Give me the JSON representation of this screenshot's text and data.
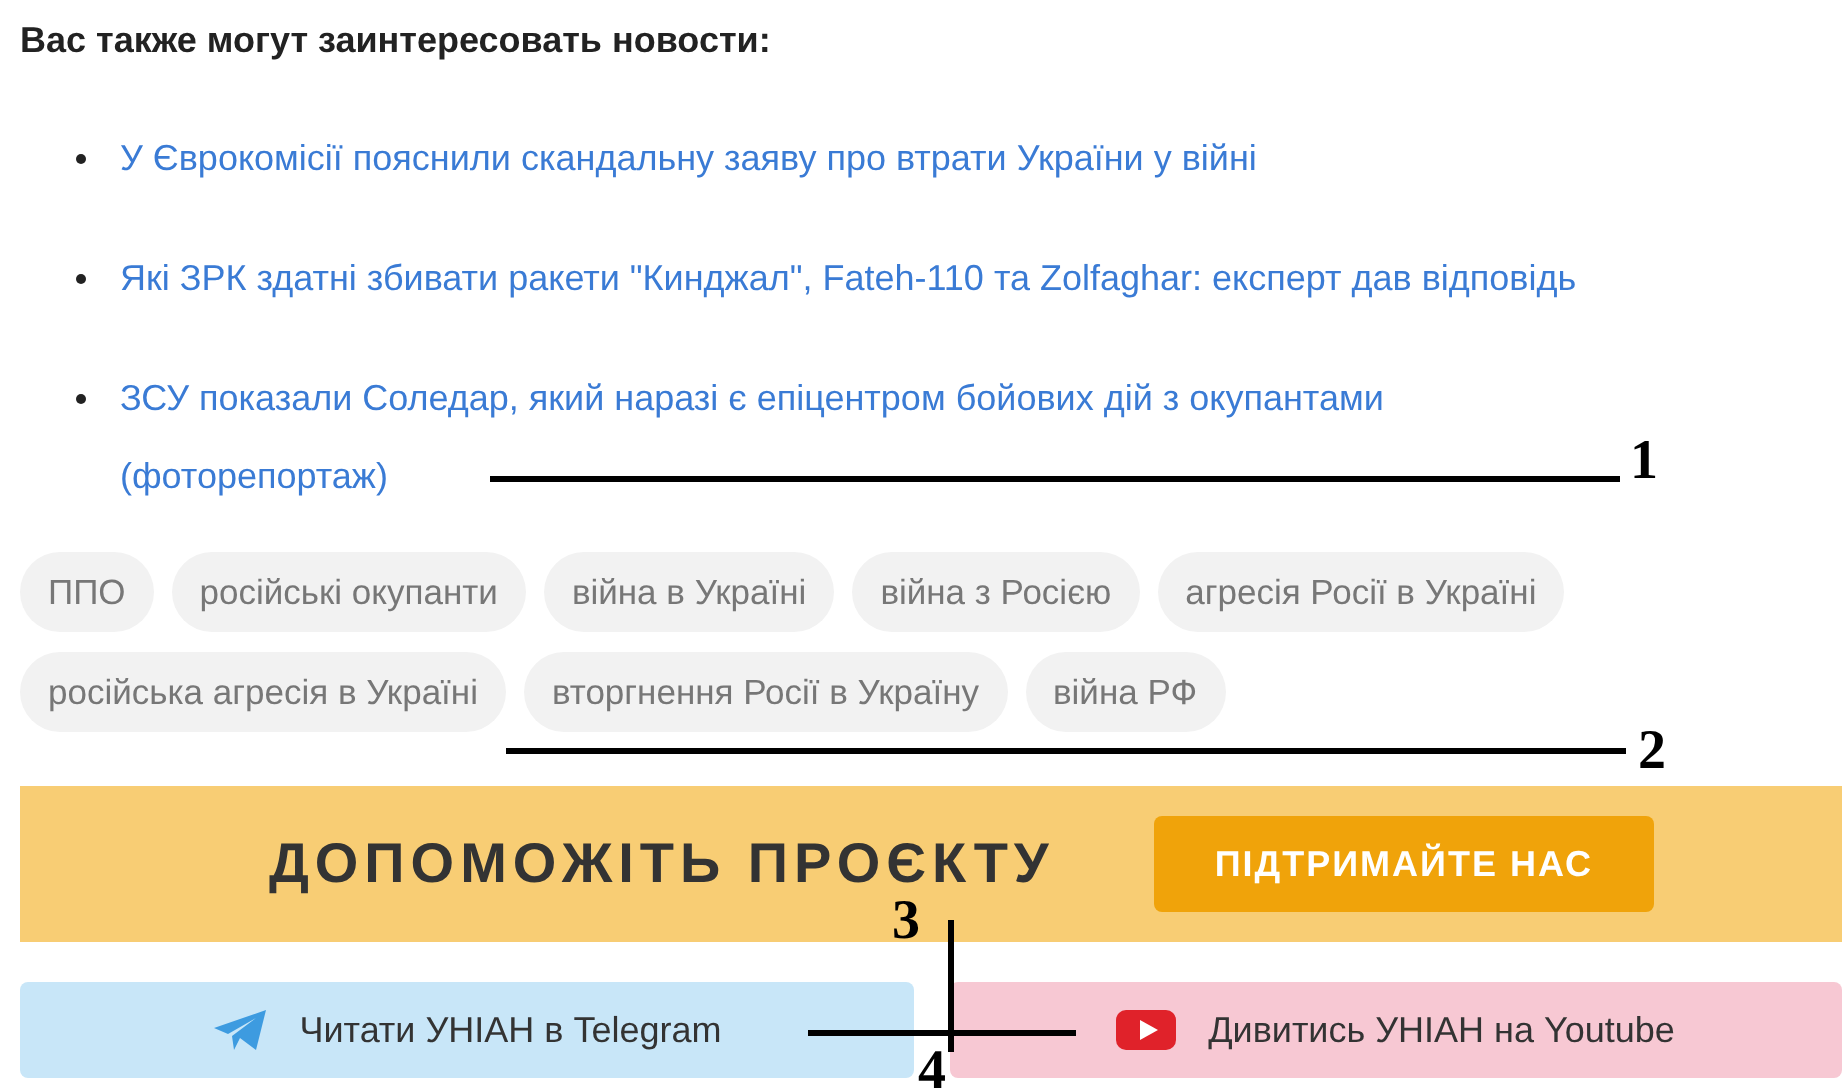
{
  "heading": "Вас также могут заинтересовать новости:",
  "news": [
    {
      "title": "У Єврокомісії пояснили скандальну заяву про втрати України у війні"
    },
    {
      "title": "Які ЗРК здатні збивати ракети \"Кинджал\", Fateh-110 та Zolfaghar: експерт дав відповідь"
    },
    {
      "title": "ЗСУ показали Соледар, який наразі є епіцентром бойових дій з окупантами (фоторепортаж)"
    }
  ],
  "tags": [
    "ППО",
    "російські окупанти",
    "війна в Україні",
    "війна з Росією",
    "агресія Росії в Україні",
    "російська агресія в Україні",
    "вторгнення Росії в Україну",
    "війна РФ"
  ],
  "banner": {
    "title": "ДОПОМОЖІТЬ ПРОЄКТУ",
    "button": "ПІДТРИМАЙТЕ НАС"
  },
  "social": [
    {
      "kind": "telegram",
      "label": "Читати УНІАН в Telegram"
    },
    {
      "kind": "youtube",
      "label": "Дивитись УНІАН на Youtube"
    }
  ],
  "annotations": [
    "1",
    "2",
    "3",
    "4"
  ]
}
